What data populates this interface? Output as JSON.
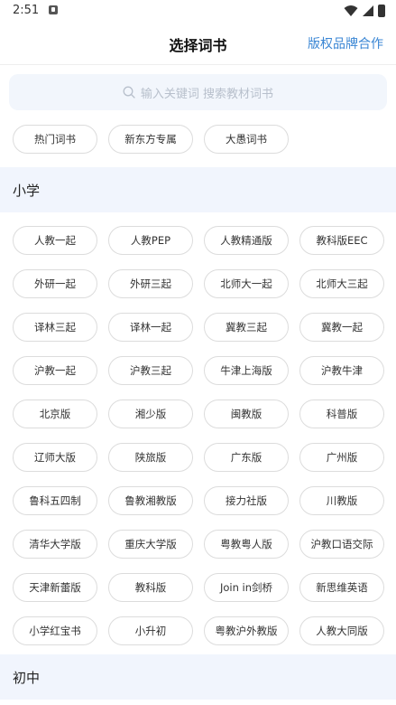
{
  "status_bar": {
    "time": "2:51"
  },
  "header": {
    "title": "选择词书",
    "partner_link": "版权品牌合作"
  },
  "search": {
    "placeholder": "输入关键词 搜索教材词书"
  },
  "hot_tags": [
    "热门词书",
    "新东方专属",
    "大愚词书"
  ],
  "sections": [
    {
      "title": "小学",
      "books": [
        "人教一起",
        "人教PEP",
        "人教精通版",
        "教科版EEC",
        "外研一起",
        "外研三起",
        "北师大一起",
        "北师大三起",
        "译林三起",
        "译林一起",
        "冀教三起",
        "冀教一起",
        "沪教一起",
        "沪教三起",
        "牛津上海版",
        "沪教牛津",
        "北京版",
        "湘少版",
        "闽教版",
        "科普版",
        "辽师大版",
        "陕旅版",
        "广东版",
        "广州版",
        "鲁科五四制",
        "鲁教湘教版",
        "接力社版",
        "川教版",
        "清华大学版",
        "重庆大学版",
        "粤教粤人版",
        "沪教口语交际",
        "天津新蕾版",
        "教科版",
        "Join in剑桥",
        "新思维英语",
        "小学红宝书",
        "小升初",
        "粤教沪外教版",
        "人教大同版"
      ]
    },
    {
      "title": "初中",
      "books": []
    }
  ]
}
